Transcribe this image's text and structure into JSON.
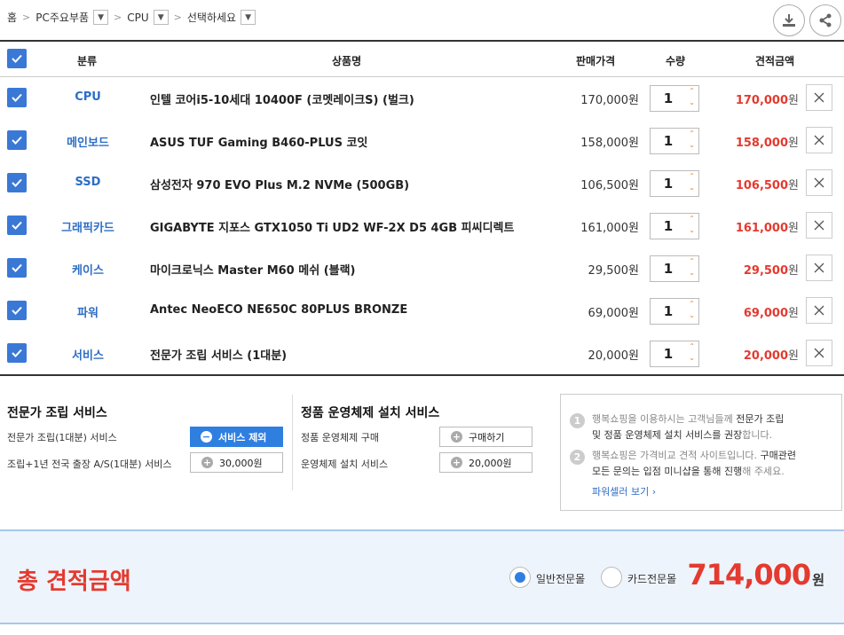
{
  "breadcrumb": {
    "home": "홈",
    "level1": "PC주요부품",
    "level2": "CPU",
    "level3": "선택하세요"
  },
  "icons": {
    "download": "download-icon",
    "share": "share-icon"
  },
  "table": {
    "headers": {
      "category": "분류",
      "product": "상품명",
      "price": "판매가격",
      "qty": "수량",
      "estimate": "견적금액"
    },
    "rows": [
      {
        "category": "CPU",
        "product": "인텔 코어i5-10세대 10400F (코멧레이크S) (벌크)",
        "price": "170,000원",
        "qty": "1",
        "estimate": "170,000"
      },
      {
        "category": "메인보드",
        "product": "ASUS TUF Gaming B460-PLUS 코잇",
        "price": "158,000원",
        "qty": "1",
        "estimate": "158,000"
      },
      {
        "category": "SSD",
        "product": "삼성전자 970 EVO Plus M.2 NVMe (500GB)",
        "price": "106,500원",
        "qty": "1",
        "estimate": "106,500"
      },
      {
        "category": "그래픽카드",
        "product": "GIGABYTE 지포스 GTX1050 Ti UD2 WF-2X D5 4GB 피씨디렉트",
        "price": "161,000원",
        "qty": "1",
        "estimate": "161,000"
      },
      {
        "category": "케이스",
        "product": "마이크로닉스 Master M60 메쉬 (블랙)",
        "price": "29,500원",
        "qty": "1",
        "estimate": "29,500"
      },
      {
        "category": "파워",
        "product": "Antec NeoECO NE650C 80PLUS BRONZE",
        "price": "69,000원",
        "qty": "1",
        "estimate": "69,000"
      },
      {
        "category": "서비스",
        "product": "전문가 조립 서비스 (1대분)",
        "price": "20,000원",
        "qty": "1",
        "estimate": "20,000"
      }
    ],
    "won": "원"
  },
  "assembly": {
    "title": "전문가 조립 서비스",
    "item1_label": "전문가 조립(1대분) 서비스",
    "item1_button": "서비스 제외",
    "item2_label": "조립+1년 전국 출장 A/S(1대분) 서비스",
    "item2_button": "30,000원"
  },
  "os": {
    "title": "정품 운영체제 설치 서비스",
    "item1_label": "정품 운영체제 구매",
    "item1_button": "구매하기",
    "item2_label": "운영체제 설치 서비스",
    "item2_button": "20,000원"
  },
  "notice": {
    "n1": "1",
    "line1a": "행복쇼핑을 이용하시는 고객님들께 ",
    "line1b": "전문가 조립",
    "line2a": "및 정품 운영체제 설치 서비스를 권장",
    "line2b": "합니다.",
    "n2": "2",
    "line3a": "행복쇼핑은 가격비교 견적 사이트입니다. ",
    "line3b": "구매관련",
    "line4a": "모든 문의는 입점 미니샵을 통해 진행",
    "line4b": "해 주세요.",
    "link": "파워셀러 보기 ›"
  },
  "total": {
    "title": "총 견적금액",
    "option1": "일반전문몰",
    "option2": "카드전문몰",
    "amount": "714,000",
    "won": "원"
  },
  "colors": {
    "accent": "#2f7fe0",
    "price_red": "#e43a2f"
  }
}
